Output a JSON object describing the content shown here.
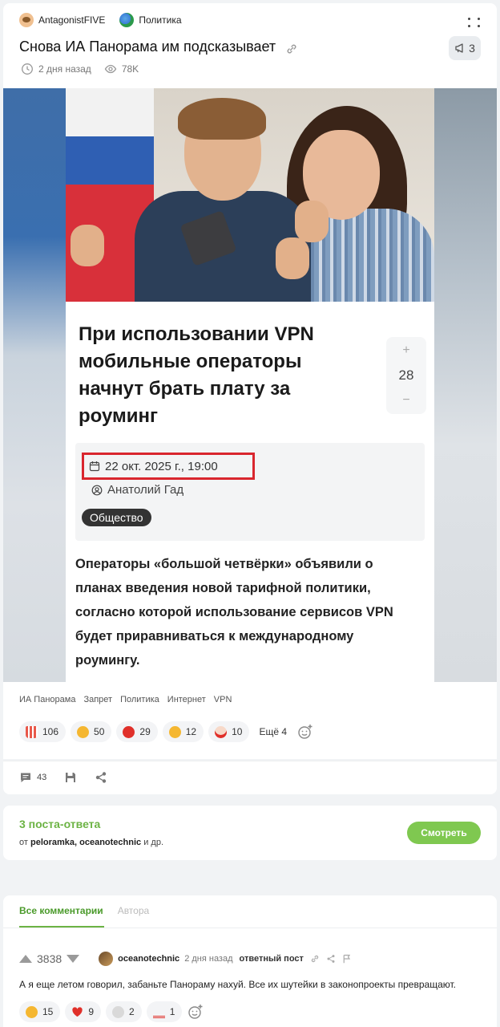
{
  "post": {
    "author": "AntagonistFIVE",
    "community": "Политика",
    "title": "Снова ИА Панорама им подсказывает",
    "replies_badge": "3",
    "time": "2 дня назад",
    "views": "78K"
  },
  "article": {
    "headline": "При использовании VPN мобильные операторы начнут брать плату за роуминг",
    "rating": "28",
    "plus": "+",
    "minus": "−",
    "date": "22 окт. 2025 г., 19:00",
    "author": "Анатолий Гад",
    "category": "Общество",
    "lead": "Операторы «большой четвёрки» объявили о планах введения новой тарифной политики, согласно которой использование сервисов VPN будет приравниваться к международному роумингу."
  },
  "tags": [
    "ИА Панорама",
    "Запрет",
    "Политика",
    "Интернет",
    "VPN"
  ],
  "reactions": [
    {
      "icon": "popcorn-emoji",
      "count": "106",
      "color": "#e8584a"
    },
    {
      "icon": "laughing-emoji",
      "count": "50",
      "color": "#f5b731"
    },
    {
      "icon": "angry-emoji",
      "count": "29",
      "color": "#e0302a"
    },
    {
      "icon": "sad-emoji",
      "count": "12",
      "color": "#f5b731"
    },
    {
      "icon": "clown-emoji",
      "count": "10",
      "color": "#f0a0a0"
    }
  ],
  "reactions_more": "Ещё 4",
  "actions": {
    "comments": "43"
  },
  "replies": {
    "title": "3 поста-ответа",
    "prefix": "от",
    "users": "peloramka, oceanotechnic",
    "suffix": "и др.",
    "button": "Смотреть"
  },
  "comments": {
    "tab_all": "Все комментарии",
    "tab_author": "Автора",
    "comment": {
      "rating": "3838",
      "user": "oceanotechnic",
      "time": "2 дня назад",
      "link": "ответный пост",
      "text": "А я еще летом говорил, забаньте Панораму нахуй. Все их шутейки в законопроекты превращают.",
      "reactions": [
        {
          "icon": "laughing-emoji",
          "count": "15",
          "color": "#f5b731"
        },
        {
          "icon": "heart-emoji",
          "count": "9",
          "color": "#e0302a"
        },
        {
          "icon": "skull-emoji",
          "count": "2",
          "color": "#cfcfcf"
        },
        {
          "icon": "hundred-emoji",
          "count": "1",
          "color": "#e0302a"
        }
      ]
    }
  },
  "colors": {
    "accent": "#6cb344",
    "highlight": "#d9262e"
  }
}
